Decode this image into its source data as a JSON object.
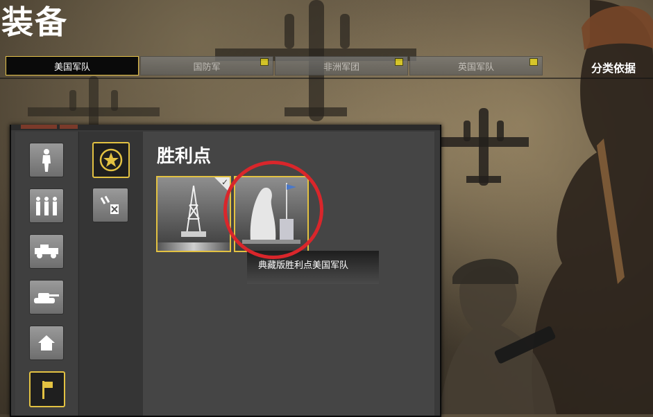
{
  "page": {
    "title": "装备"
  },
  "tabs": [
    {
      "label": "美国军队",
      "active": true,
      "marker": false
    },
    {
      "label": "国防军",
      "active": false,
      "marker": true
    },
    {
      "label": "非洲军团",
      "active": false,
      "marker": true
    },
    {
      "label": "英国军队",
      "active": false,
      "marker": true
    }
  ],
  "sort": {
    "label": "分类依据"
  },
  "sidebar": {
    "categories": [
      {
        "icon": "infantry-soldier-icon",
        "active": false
      },
      {
        "icon": "squad-icon",
        "active": false
      },
      {
        "icon": "jeep-icon",
        "active": false
      },
      {
        "icon": "tank-icon",
        "active": false
      },
      {
        "icon": "house-icon",
        "active": false
      },
      {
        "icon": "flag-icon",
        "active": true
      }
    ]
  },
  "subcategories": [
    {
      "icon": "star-icon",
      "active": true
    },
    {
      "icon": "shredded-item-icon",
      "active": false
    }
  ],
  "section": {
    "title": "胜利点"
  },
  "items": [
    {
      "name": "victory-point-standard",
      "selected": true
    },
    {
      "name": "victory-point-collector-us",
      "selected": false
    }
  ],
  "tooltip": {
    "text": "典藏版胜利点美国军队"
  },
  "colors": {
    "accent": "#e3c242",
    "highlight_circle": "#d9262b",
    "marker": "#f3e21c"
  }
}
